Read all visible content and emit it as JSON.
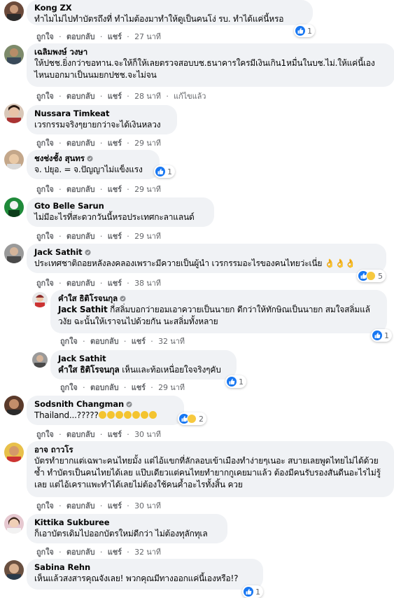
{
  "action_labels": {
    "like": "ถูกใจ",
    "reply": "ตอบกลับ",
    "share": "แชร์",
    "edited": "แก้ไขแล้ว",
    "sep": "·"
  },
  "comments": [
    {
      "author": "Kong ZX",
      "text": "ทำไมไม่ไปทำบัตรถึงที่ ทำไมต้องมาทำให้ดูเป็นคนโง่ รบ. ทำได้แค่นี้หรอ",
      "time": "27 นาที",
      "reactions": "1"
    },
    {
      "author": "เฉลิมพงษ์ วงษา",
      "text": "ให้ปชช.ยิ่งกว่าขอทาน.จะให้ก็ให้เลยตรวจสอบบช.ธนาคารใครมีเงินเกิน1หมื่นในบช.ไม่.ให้แค่นี้เองไหนบอกมาเป็นนมยกปชช.จะไม่จน",
      "time": "28 นาที",
      "edited": true
    },
    {
      "author": "Nussara Timkeat",
      "text": "เวรกรรมจริงๆยายกว่าจะได้เงินหลวง",
      "time": "29 นาที"
    },
    {
      "author": "ชงช่งชั้ง สุนทร",
      "text": "จ. ปยุอ. = จ.ปัญญาไม่แข็งแรง",
      "time": "29 นาที",
      "reactions": "1"
    },
    {
      "author": "Gto Belle Sarun",
      "text": "ไม่มีอะไรที่สะดวกวันนี้หรอประเทศกะลาแลนด์",
      "time": "29 นาที"
    },
    {
      "author": "Jack Sathit",
      "text": "ประเทศชาติถอยหลังลงคลองเพราะมีควายเป็นผู้นำ เวรกรรมอะไรของคนไทยว่ะเนี่ย",
      "time": "38 นาที",
      "reactions": "5"
    },
    {
      "author": "คำใส ธิติโรจนกุล",
      "mention": "Jack Sathit",
      "text": " กี่สลิ่มบอกว่ายอมเอาควายเป็นนายก ดีกว่าให้ทักษิณเป็นนายก สมใจสลิ่มแล้วงัย ฉะนั้นให้เราจนไปด้วยกัน นะสลิ่มทั้งหลาย",
      "time": "32 นาที",
      "reactions": "1"
    },
    {
      "author": "Jack Sathit",
      "mention": "คำใส ธิติโรจนกุล",
      "text": " เห็นและท้อเหนื่อยใจจริงๆคับ",
      "time": "29 นาที",
      "reactions": "1"
    },
    {
      "author": "Sodsnith Changman",
      "text": "Thailand...?????",
      "time": "30 นาที",
      "reactions": "2"
    },
    {
      "author": "อาจ ถาวโร",
      "text": "บัตรทำยากแต่เฉพาะคนไทยมั้ง แต่ไอ้แขกที่ลักลอบเข้าเมืองทำง่ายๆเนอะ สบายเลยพูดไทยไม่ได้ด้วยซ้ำ ทำบัตรเป็นคนไทยได้เลย แป๊บเดียวแต่คนไทยทำยากกูเคยมาแล้ว ต้องมีคนรับรองสันดีนอะไรไม่รู้เลย แต่ไอ้เคราแพะทำได้เลยไม่ต้องใช้คนค้ำอะไรทั้งสิ้น ควย",
      "time": "30 นาที"
    },
    {
      "author": "Kittika Sukburee",
      "text": "ก็เอาบัตรเดิมไปออกบัตรใหม่ดีกว่า ไม่ต้องทุลักทุเล",
      "time": "32 นาที"
    },
    {
      "author": "Sabina Rehn",
      "text": "เห็นแล้วสงสารคุณจังเลย! พวกคุณมีทางออกแค่นี้เองหรือ!?",
      "time": "",
      "reactions": "1"
    }
  ],
  "colors": {
    "bubble": "#f0f2f5",
    "meta": "#65676b",
    "like_blue": "#1877f2"
  }
}
